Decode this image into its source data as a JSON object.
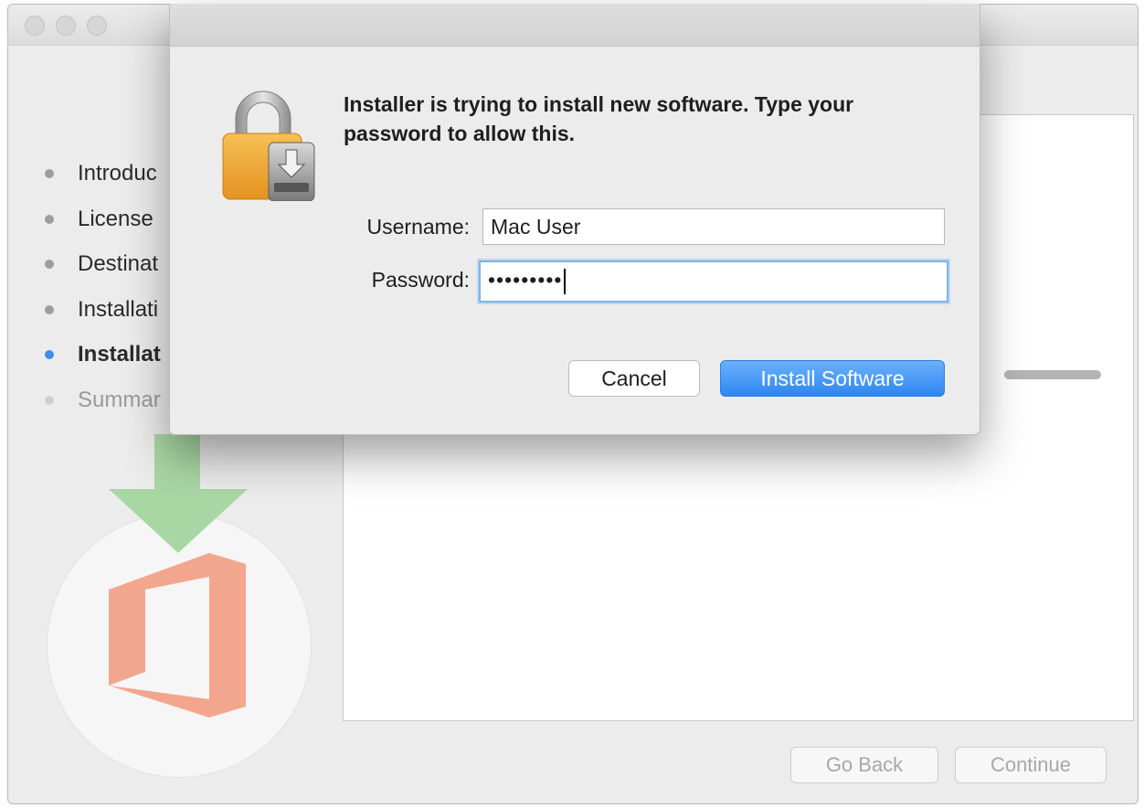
{
  "installer": {
    "steps": [
      {
        "label": "Introduc",
        "state": "done"
      },
      {
        "label": "License",
        "state": "done"
      },
      {
        "label": "Destinat",
        "state": "done"
      },
      {
        "label": "Installati",
        "state": "done"
      },
      {
        "label": "Installat",
        "state": "active"
      },
      {
        "label": "Summar",
        "state": "pending"
      }
    ],
    "buttons": {
      "go_back": "Go Back",
      "continue": "Continue"
    },
    "colors": {
      "active_step": "#3f8fe6",
      "logo_arrow": "#a9d7a4",
      "office_logo": "#f3a68e"
    }
  },
  "auth_dialog": {
    "message": "Installer is trying to install new software. Type your password to allow this.",
    "username_label": "Username:",
    "username_value": "Mac User",
    "password_label": "Password:",
    "password_value": "•••••••••",
    "cancel_label": "Cancel",
    "install_label": "Install Software",
    "colors": {
      "primary_button": "#2e86f2",
      "focus_ring": "#7db1ea"
    }
  }
}
